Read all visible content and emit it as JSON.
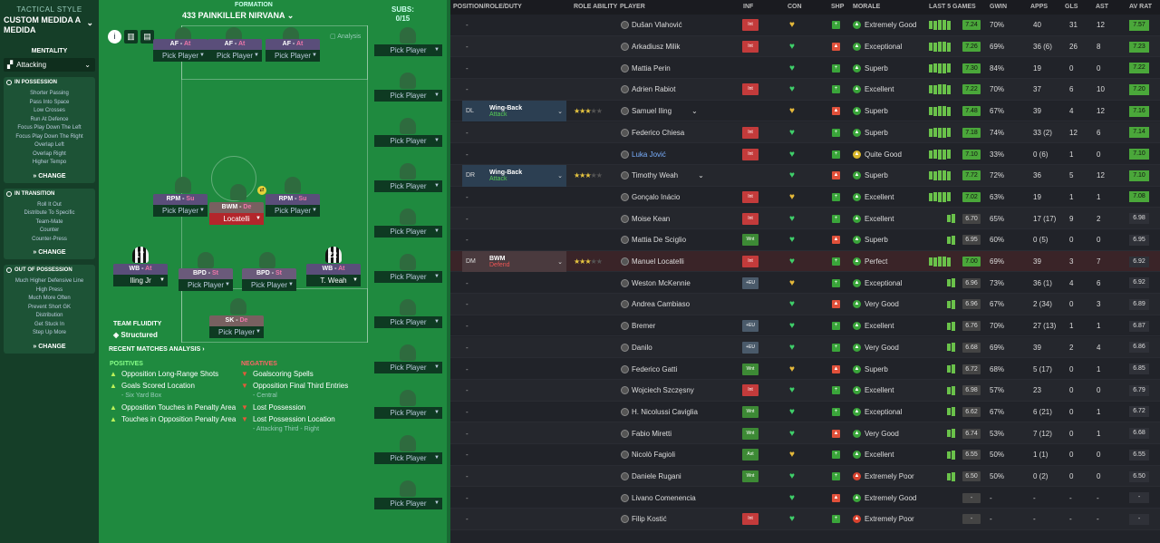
{
  "sidebar": {
    "tactical_style": "TACTICAL STYLE",
    "tactic_name": "CUSTOM MEDIDA A MEDIDA",
    "mentality_label": "MENTALITY",
    "mentality_value": "Attacking",
    "in_possession": {
      "title": "IN POSSESSION",
      "items": [
        "Shorter Passing",
        "Pass Into Space",
        "Low Crosses",
        "Run At Defence",
        "Focus Play Down The Left",
        "Focus Play Down The Right",
        "Overlap Left",
        "Overlap Right",
        "Higher Tempo"
      ],
      "change": "CHANGE"
    },
    "in_transition": {
      "title": "IN TRANSITION",
      "items": [
        "Roll It Out",
        "Distribute To Specific",
        "Team-Mate",
        "Counter",
        "Counter-Press"
      ],
      "change": "CHANGE"
    },
    "out_of_possession": {
      "title": "OUT OF POSSESSION",
      "items": [
        "Much Higher Defensive Line",
        "High Press",
        "Much More Often",
        "Prevent Short GK",
        "Distribution",
        "Get Stuck In",
        "Step Up More"
      ],
      "change": "CHANGE"
    }
  },
  "pitch": {
    "formation_label": "FORMATION",
    "formation_name": "433 PAINKILLER NIRVANA",
    "subs_label": "SUBS:",
    "subs_count": "0/15",
    "analysis": "Analysis",
    "slots": [
      {
        "role": "AF",
        "duty": "At",
        "player": "Pick Player"
      },
      {
        "role": "AF",
        "duty": "At",
        "player": "Pick Player"
      },
      {
        "role": "AF",
        "duty": "At",
        "player": "Pick Player"
      },
      {
        "role": "RPM",
        "duty": "Su",
        "player": "Pick Player"
      },
      {
        "role": "BWM",
        "duty": "De",
        "player": "Locatelli"
      },
      {
        "role": "RPM",
        "duty": "Su",
        "player": "Pick Player"
      },
      {
        "role": "WB",
        "duty": "At",
        "player": "Iling Jr"
      },
      {
        "role": "BPD",
        "duty": "St",
        "player": "Pick Player"
      },
      {
        "role": "BPD",
        "duty": "St",
        "player": "Pick Player"
      },
      {
        "role": "WB",
        "duty": "At",
        "player": "T. Weah"
      },
      {
        "role": "SK",
        "duty": "De",
        "player": "Pick Player"
      }
    ],
    "shirt_numbers": [
      "17",
      "22"
    ],
    "sub_label": "Pick Player",
    "fluidity_label": "TEAM FLUIDITY",
    "fluidity_value": "Structured",
    "recent_label": "RECENT MATCHES ANALYSIS",
    "positives_label": "POSITIVES",
    "negatives_label": "NEGATIVES",
    "positives": [
      {
        "t": "Opposition Long-Range Shots",
        "s": ""
      },
      {
        "t": "Goals Scored Location",
        "s": "- Six Yard Box"
      },
      {
        "t": "Opposition Touches in Penalty Area",
        "s": ""
      },
      {
        "t": "Touches in Opposition Penalty Area",
        "s": ""
      }
    ],
    "negatives": [
      {
        "t": "Goalscoring Spells",
        "s": ""
      },
      {
        "t": "Opposition Final Third Entries",
        "s": "- Central"
      },
      {
        "t": "Lost Possession",
        "s": ""
      },
      {
        "t": "Lost Possession Location",
        "s": "- Attacking Third - Right"
      }
    ]
  },
  "table": {
    "headers": {
      "pos": "POSITION/ROLE/DUTY",
      "ability": "ROLE ABILITY",
      "player": "PLAYER",
      "inf": "INF",
      "con": "CON",
      "shp": "SHP",
      "morale": "MORALE",
      "last5": "LAST 5 GAMES",
      "gwin": "GWIN",
      "apps": "APPS",
      "gls": "GLS",
      "ast": "AST",
      "avrat": "AV RAT"
    },
    "rows": [
      {
        "pos": "",
        "role": "",
        "duty": "",
        "stars": 0,
        "name": "Dušan Vlahović",
        "inf": "Int",
        "morale": "Extremely Good",
        "rating": "7.24",
        "gwin": "70%",
        "apps": "40",
        "gls": "31",
        "ast": "12",
        "av": "7.57"
      },
      {
        "pos": "",
        "role": "",
        "duty": "",
        "stars": 0,
        "name": "Arkadiusz Milik",
        "inf": "Int",
        "morale": "Exceptional",
        "rating": "7.26",
        "gwin": "69%",
        "apps": "36 (6)",
        "gls": "26",
        "ast": "8",
        "av": "7.23"
      },
      {
        "pos": "",
        "role": "",
        "duty": "",
        "stars": 0,
        "name": "Mattia Perin",
        "inf": "",
        "morale": "Superb",
        "rating": "7.30",
        "gwin": "84%",
        "apps": "19",
        "gls": "0",
        "ast": "0",
        "av": "7.22"
      },
      {
        "pos": "",
        "role": "",
        "duty": "",
        "stars": 0,
        "name": "Adrien Rabiot",
        "inf": "Int",
        "morale": "Excellent",
        "rating": "7.22",
        "gwin": "70%",
        "apps": "37",
        "gls": "6",
        "ast": "10",
        "av": "7.20"
      },
      {
        "pos": "DL",
        "role": "Wing-Back",
        "duty": "Attack",
        "stars": 3,
        "name": "Samuel Iling",
        "inf": "",
        "morale": "Superb",
        "rating": "7.48",
        "gwin": "67%",
        "apps": "39",
        "gls": "4",
        "ast": "12",
        "av": "7.16"
      },
      {
        "pos": "",
        "role": "",
        "duty": "",
        "stars": 0,
        "name": "Federico Chiesa",
        "inf": "Int",
        "morale": "Superb",
        "rating": "7.18",
        "gwin": "74%",
        "apps": "33 (2)",
        "gls": "12",
        "ast": "6",
        "av": "7.14"
      },
      {
        "pos": "",
        "role": "",
        "duty": "",
        "stars": 0,
        "name": "Luka Jović",
        "inf": "Int",
        "morale": "Quite Good",
        "rating": "7.10",
        "gwin": "33%",
        "apps": "0 (6)",
        "gls": "1",
        "ast": "0",
        "av": "7.10"
      },
      {
        "pos": "DR",
        "role": "Wing-Back",
        "duty": "Attack",
        "stars": 2.5,
        "name": "Timothy Weah",
        "inf": "",
        "morale": "Superb",
        "rating": "7.72",
        "gwin": "72%",
        "apps": "36",
        "gls": "5",
        "ast": "12",
        "av": "7.10"
      },
      {
        "pos": "",
        "role": "",
        "duty": "",
        "stars": 0,
        "name": "Gonçalo Inácio",
        "inf": "Int",
        "morale": "Excellent",
        "rating": "7.02",
        "gwin": "63%",
        "apps": "19",
        "gls": "1",
        "ast": "1",
        "av": "7.08"
      },
      {
        "pos": "",
        "role": "",
        "duty": "",
        "stars": 0,
        "name": "Moise Kean",
        "inf": "Int",
        "morale": "Excellent",
        "rating": "6.70",
        "gwin": "65%",
        "apps": "17 (17)",
        "gls": "9",
        "ast": "2",
        "av": "6.98"
      },
      {
        "pos": "",
        "role": "",
        "duty": "",
        "stars": 0,
        "name": "Mattia De Sciglio",
        "inf": "Wnt",
        "morale": "Superb",
        "rating": "6.95",
        "gwin": "60%",
        "apps": "0 (5)",
        "gls": "0",
        "ast": "0",
        "av": "6.95"
      },
      {
        "pos": "DM",
        "role": "BWM",
        "duty": "Defend",
        "stars": 3,
        "name": "Manuel Locatelli",
        "inf": "Int",
        "morale": "Perfect",
        "rating": "7.00",
        "gwin": "69%",
        "apps": "39",
        "gls": "3",
        "ast": "7",
        "av": "6.92"
      },
      {
        "pos": "",
        "role": "",
        "duty": "",
        "stars": 0,
        "name": "Weston McKennie",
        "inf": "+EU",
        "morale": "Exceptional",
        "rating": "6.96",
        "gwin": "73%",
        "apps": "36 (1)",
        "gls": "4",
        "ast": "6",
        "av": "6.92"
      },
      {
        "pos": "",
        "role": "",
        "duty": "",
        "stars": 0,
        "name": "Andrea Cambiaso",
        "inf": "",
        "morale": "Very Good",
        "rating": "6.96",
        "gwin": "67%",
        "apps": "2 (34)",
        "gls": "0",
        "ast": "3",
        "av": "6.89"
      },
      {
        "pos": "",
        "role": "",
        "duty": "",
        "stars": 0,
        "name": "Bremer",
        "inf": "+EU",
        "morale": "Excellent",
        "rating": "6.76",
        "gwin": "70%",
        "apps": "27 (13)",
        "gls": "1",
        "ast": "1",
        "av": "6.87"
      },
      {
        "pos": "",
        "role": "",
        "duty": "",
        "stars": 0,
        "name": "Danilo",
        "inf": "+EU",
        "morale": "Very Good",
        "rating": "6.68",
        "gwin": "69%",
        "apps": "39",
        "gls": "2",
        "ast": "4",
        "av": "6.86"
      },
      {
        "pos": "",
        "role": "",
        "duty": "",
        "stars": 0,
        "name": "Federico Gatti",
        "inf": "Wnt",
        "morale": "Superb",
        "rating": "6.72",
        "gwin": "68%",
        "apps": "5 (17)",
        "gls": "0",
        "ast": "1",
        "av": "6.85"
      },
      {
        "pos": "",
        "role": "",
        "duty": "",
        "stars": 0,
        "name": "Wojciech Szczęsny",
        "inf": "Int",
        "morale": "Excellent",
        "rating": "6.98",
        "gwin": "57%",
        "apps": "23",
        "gls": "0",
        "ast": "0",
        "av": "6.79"
      },
      {
        "pos": "",
        "role": "",
        "duty": "",
        "stars": 0,
        "name": "H. Nicolussi Caviglia",
        "inf": "Wnt",
        "morale": "Exceptional",
        "rating": "6.62",
        "gwin": "67%",
        "apps": "6 (21)",
        "gls": "0",
        "ast": "1",
        "av": "6.72"
      },
      {
        "pos": "",
        "role": "",
        "duty": "",
        "stars": 0,
        "name": "Fabio Miretti",
        "inf": "Wnt",
        "morale": "Very Good",
        "rating": "6.74",
        "gwin": "53%",
        "apps": "7 (12)",
        "gls": "0",
        "ast": "1",
        "av": "6.68"
      },
      {
        "pos": "",
        "role": "",
        "duty": "",
        "stars": 0,
        "name": "Nicolò Fagioli",
        "inf": "Ast",
        "morale": "Excellent",
        "rating": "6.55",
        "gwin": "50%",
        "apps": "1 (1)",
        "gls": "0",
        "ast": "0",
        "av": "6.55"
      },
      {
        "pos": "",
        "role": "",
        "duty": "",
        "stars": 0,
        "name": "Daniele Rugani",
        "inf": "Wnt",
        "morale": "Extremely Poor",
        "rating": "6.50",
        "gwin": "50%",
        "apps": "0 (2)",
        "gls": "0",
        "ast": "0",
        "av": "6.50"
      },
      {
        "pos": "",
        "role": "",
        "duty": "",
        "stars": 0,
        "name": "Livano Comenencia",
        "inf": "",
        "morale": "Extremely Good",
        "rating": "-",
        "gwin": "-",
        "apps": "-",
        "gls": "-",
        "ast": "-",
        "av": "-"
      },
      {
        "pos": "",
        "role": "",
        "duty": "",
        "stars": 0,
        "name": "Filip Kostić",
        "inf": "Int",
        "morale": "Extremely Poor",
        "rating": "-",
        "gwin": "-",
        "apps": "-",
        "gls": "-",
        "ast": "-",
        "av": "-"
      }
    ]
  }
}
